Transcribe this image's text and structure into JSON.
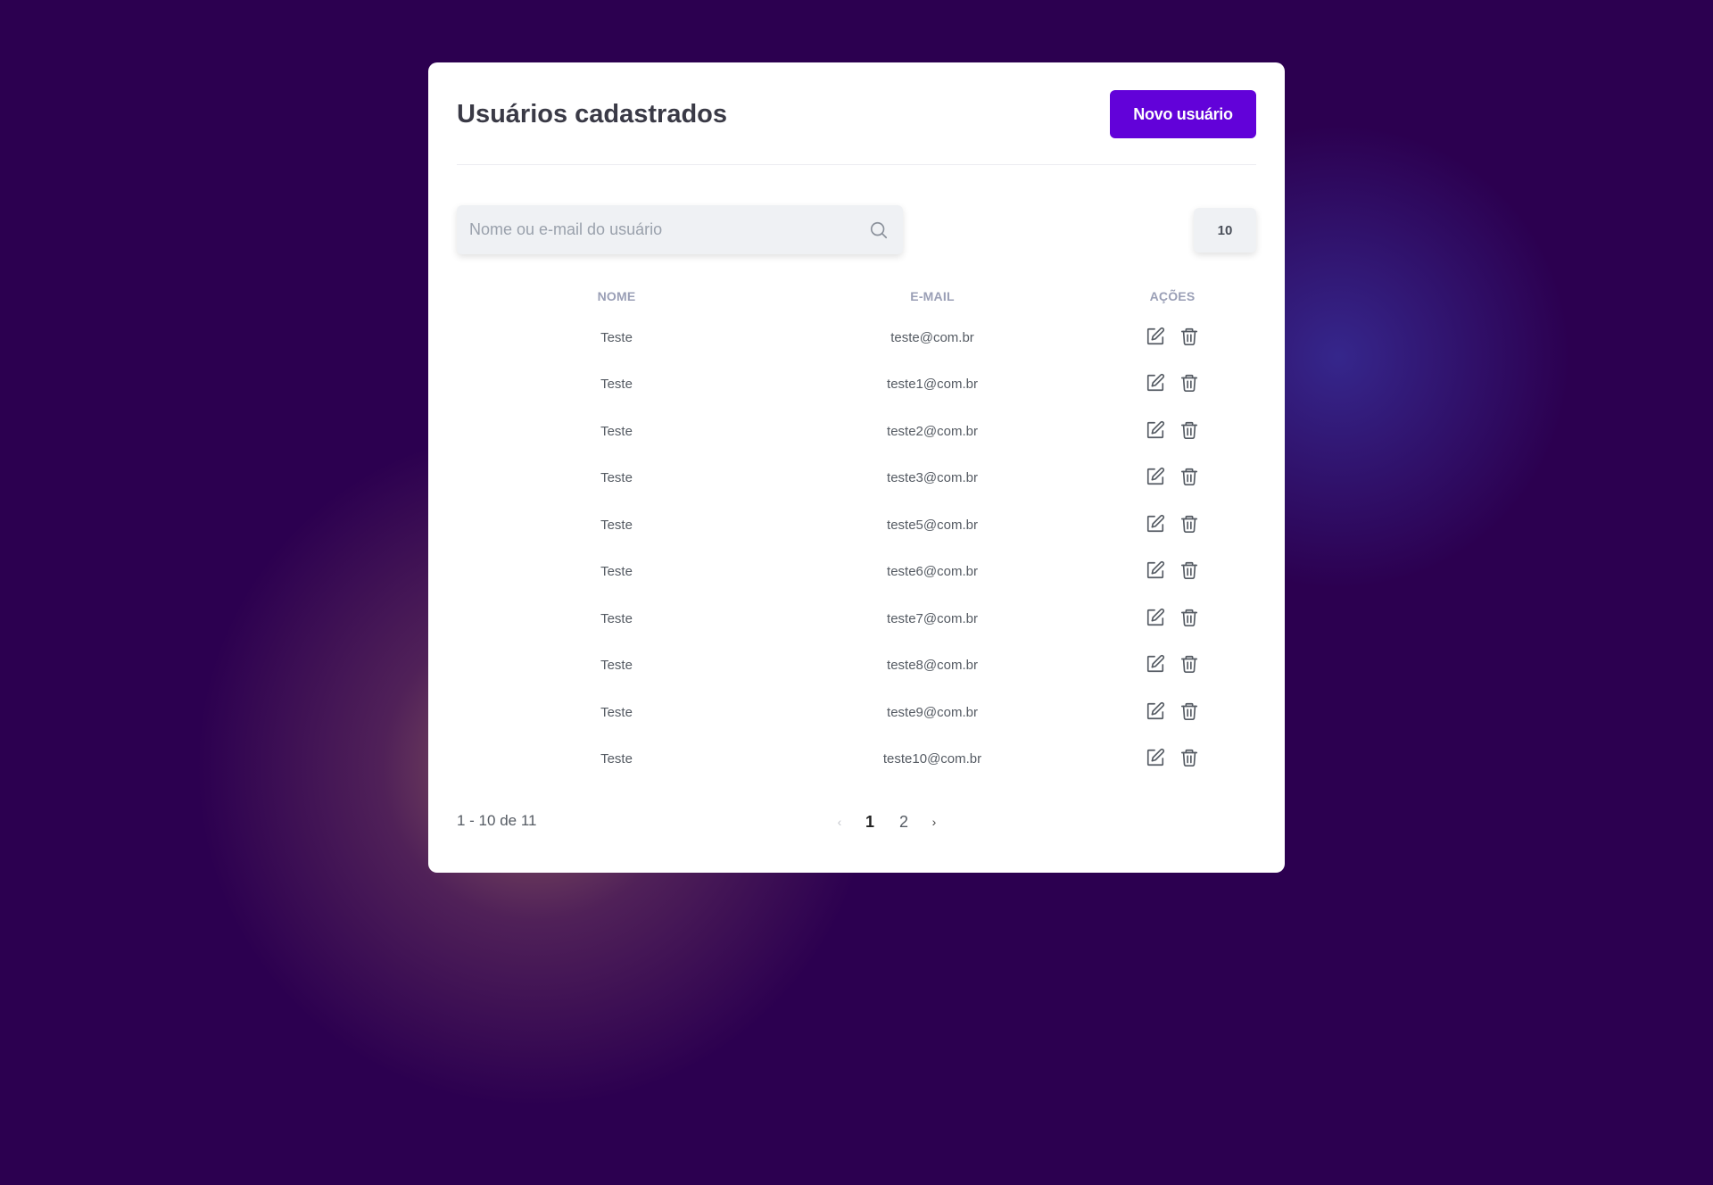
{
  "header": {
    "title": "Usuários cadastrados",
    "new_user_label": "Novo usuário"
  },
  "search": {
    "placeholder": "Nome ou e-mail do usuário",
    "value": ""
  },
  "page_size": "10",
  "table": {
    "columns": [
      "NOME",
      "E-MAIL",
      "AÇÕES"
    ],
    "rows": [
      {
        "name": "Teste",
        "email": "teste@com.br"
      },
      {
        "name": "Teste",
        "email": "teste1@com.br"
      },
      {
        "name": "Teste",
        "email": "teste2@com.br"
      },
      {
        "name": "Teste",
        "email": "teste3@com.br"
      },
      {
        "name": "Teste",
        "email": "teste5@com.br"
      },
      {
        "name": "Teste",
        "email": "teste6@com.br"
      },
      {
        "name": "Teste",
        "email": "teste7@com.br"
      },
      {
        "name": "Teste",
        "email": "teste8@com.br"
      },
      {
        "name": "Teste",
        "email": "teste9@com.br"
      },
      {
        "name": "Teste",
        "email": "teste10@com.br"
      }
    ],
    "row_actions": [
      "edit-icon",
      "trash-icon"
    ]
  },
  "footer": {
    "range_text": "1 - 10 de 11",
    "pages": [
      "1",
      "2"
    ],
    "current_page": "1",
    "prev_symbol": "‹",
    "next_symbol": "›"
  },
  "colors": {
    "background": "#2c0050",
    "accent": "#6202d9",
    "card": "#ffffff"
  }
}
